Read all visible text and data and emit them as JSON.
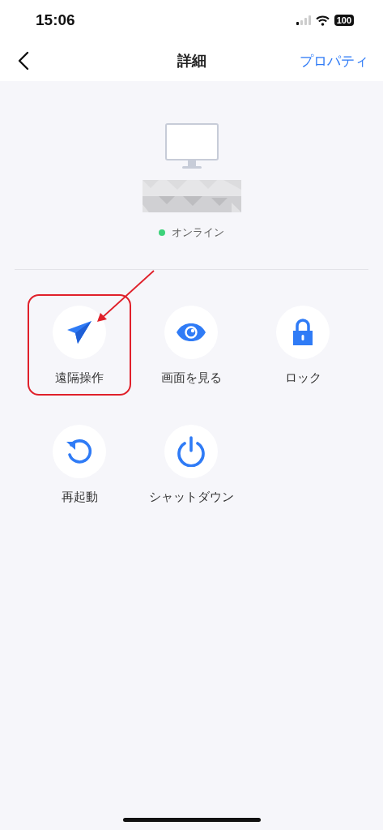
{
  "status_bar": {
    "time": "15:06",
    "battery": "100"
  },
  "nav": {
    "title": "詳細",
    "action": "プロパティ"
  },
  "device": {
    "status": "オンライン",
    "online": true
  },
  "actions": [
    {
      "kind": "send",
      "label": "遠隔操作",
      "highlighted": true
    },
    {
      "kind": "eye",
      "label": "画面を見る",
      "highlighted": false
    },
    {
      "kind": "lock",
      "label": "ロック",
      "highlighted": false
    },
    {
      "kind": "restart",
      "label": "再起動",
      "highlighted": false
    },
    {
      "kind": "power",
      "label": "シャットダウン",
      "highlighted": false
    }
  ]
}
